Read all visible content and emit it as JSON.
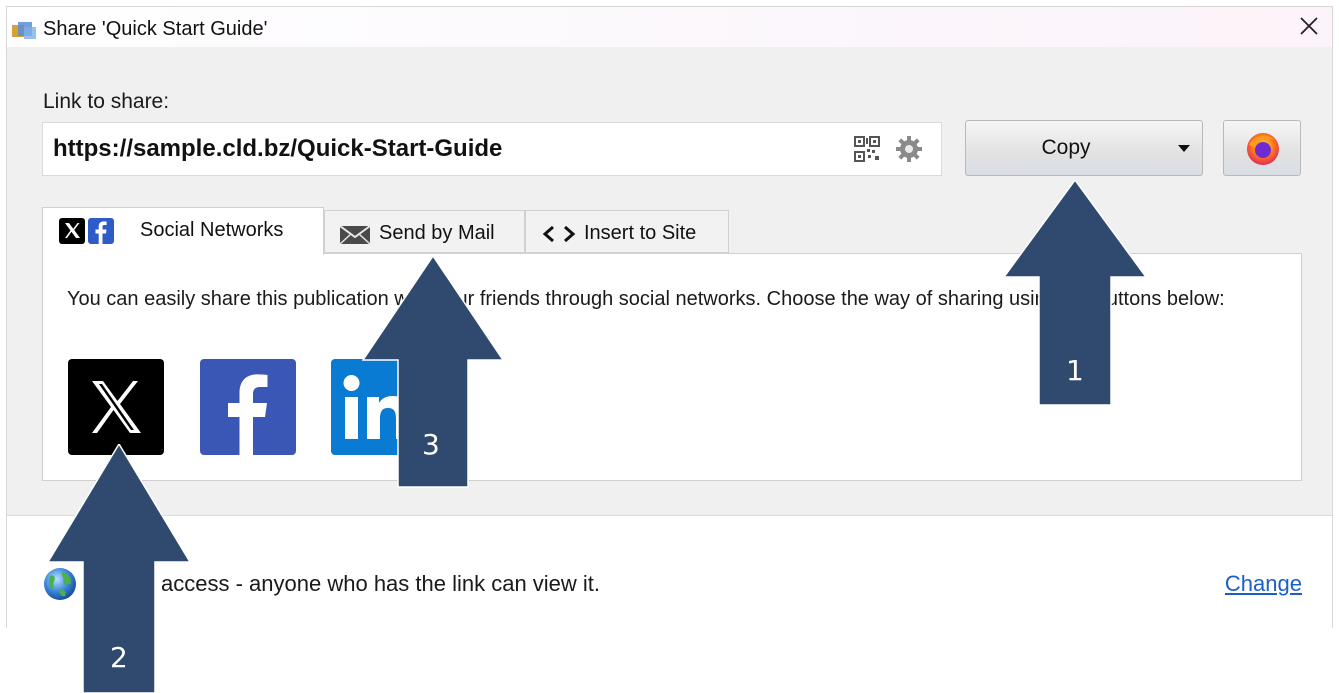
{
  "window": {
    "title": "Share 'Quick Start Guide'",
    "close_label": "✕"
  },
  "link": {
    "label": "Link to share:",
    "url": "https://sample.cld.bz/Quick-Start-Guide",
    "copy_label": "Copy"
  },
  "tabs": [
    {
      "label": "Social Networks",
      "active": true
    },
    {
      "label": "Send by Mail",
      "active": false
    },
    {
      "label": "Insert to Site",
      "active": false
    }
  ],
  "panel": {
    "description": "You can easily share this publication with your friends through social networks. Choose the way of sharing using the buttons below:"
  },
  "footer": {
    "access_text": "Public access - anyone who has the link can view it.",
    "change_label": "Change"
  },
  "annotations": [
    {
      "number": "1"
    },
    {
      "number": "2"
    },
    {
      "number": "3"
    }
  ],
  "colors": {
    "arrow": "#2f4a6e",
    "x_button": "#000000",
    "facebook": "#3b57b6",
    "linkedin": "#0a7bd2",
    "link": "#1c5ec9"
  },
  "icons": [
    "app-share-icon",
    "close-icon",
    "qr-code-icon",
    "gear-icon",
    "dropdown-caret-icon",
    "firefox-icon",
    "x-logo-icon",
    "facebook-logo-icon",
    "envelope-icon",
    "code-brackets-icon",
    "linkedin-logo-icon",
    "globe-icon"
  ]
}
